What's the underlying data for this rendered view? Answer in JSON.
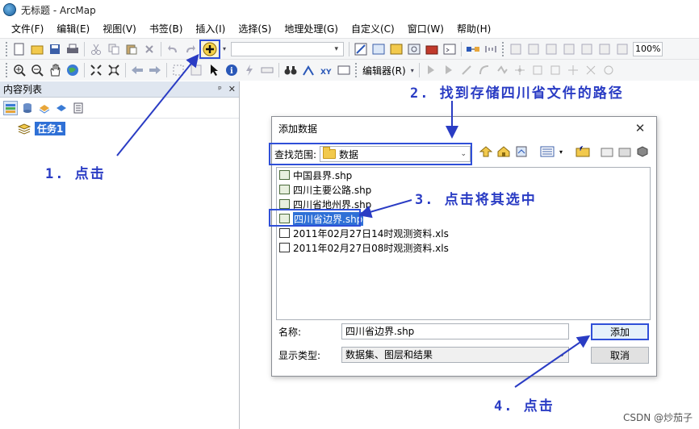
{
  "window": {
    "title": "无标题 - ArcMap"
  },
  "menubar": [
    "文件(F)",
    "编辑(E)",
    "视图(V)",
    "书签(B)",
    "插入(I)",
    "选择(S)",
    "地理处理(G)",
    "自定义(C)",
    "窗口(W)",
    "帮助(H)"
  ],
  "toolbar": {
    "zoom_level": "100%",
    "editor_label": "编辑器(R)"
  },
  "toc": {
    "title": "内容列表",
    "pin": "ᵖ",
    "close": "✕",
    "layer": "任务1"
  },
  "dialog": {
    "title": "添加数据",
    "close": "✕",
    "look_in_label": "查找范围:",
    "look_in_value": "数据",
    "files": [
      {
        "name": "中国县界.shp",
        "kind": "polygon"
      },
      {
        "name": "四川主要公路.shp",
        "kind": "line"
      },
      {
        "name": "四川省地州界.shp",
        "kind": "polygon"
      },
      {
        "name": "四川省边界.shp",
        "kind": "polygon",
        "selected": true
      },
      {
        "name": "2011年02月27日14时观测资料.xls",
        "kind": "table"
      },
      {
        "name": "2011年02月27日08时观测资料.xls",
        "kind": "table"
      }
    ],
    "name_label": "名称:",
    "name_value": "四川省边界.shp",
    "type_label": "显示类型:",
    "type_value": "数据集、图层和结果",
    "add_button": "添加",
    "cancel_button": "取消"
  },
  "annotations": {
    "step1": "1. 点击",
    "step2": "2. 找到存储四川省文件的路径",
    "step3": "3. 点击将其选中",
    "step4": "4. 点击"
  },
  "watermark": "CSDN @炒茄子",
  "colors": {
    "annotation": "#2a3cc4",
    "selection": "#2f70d6"
  }
}
